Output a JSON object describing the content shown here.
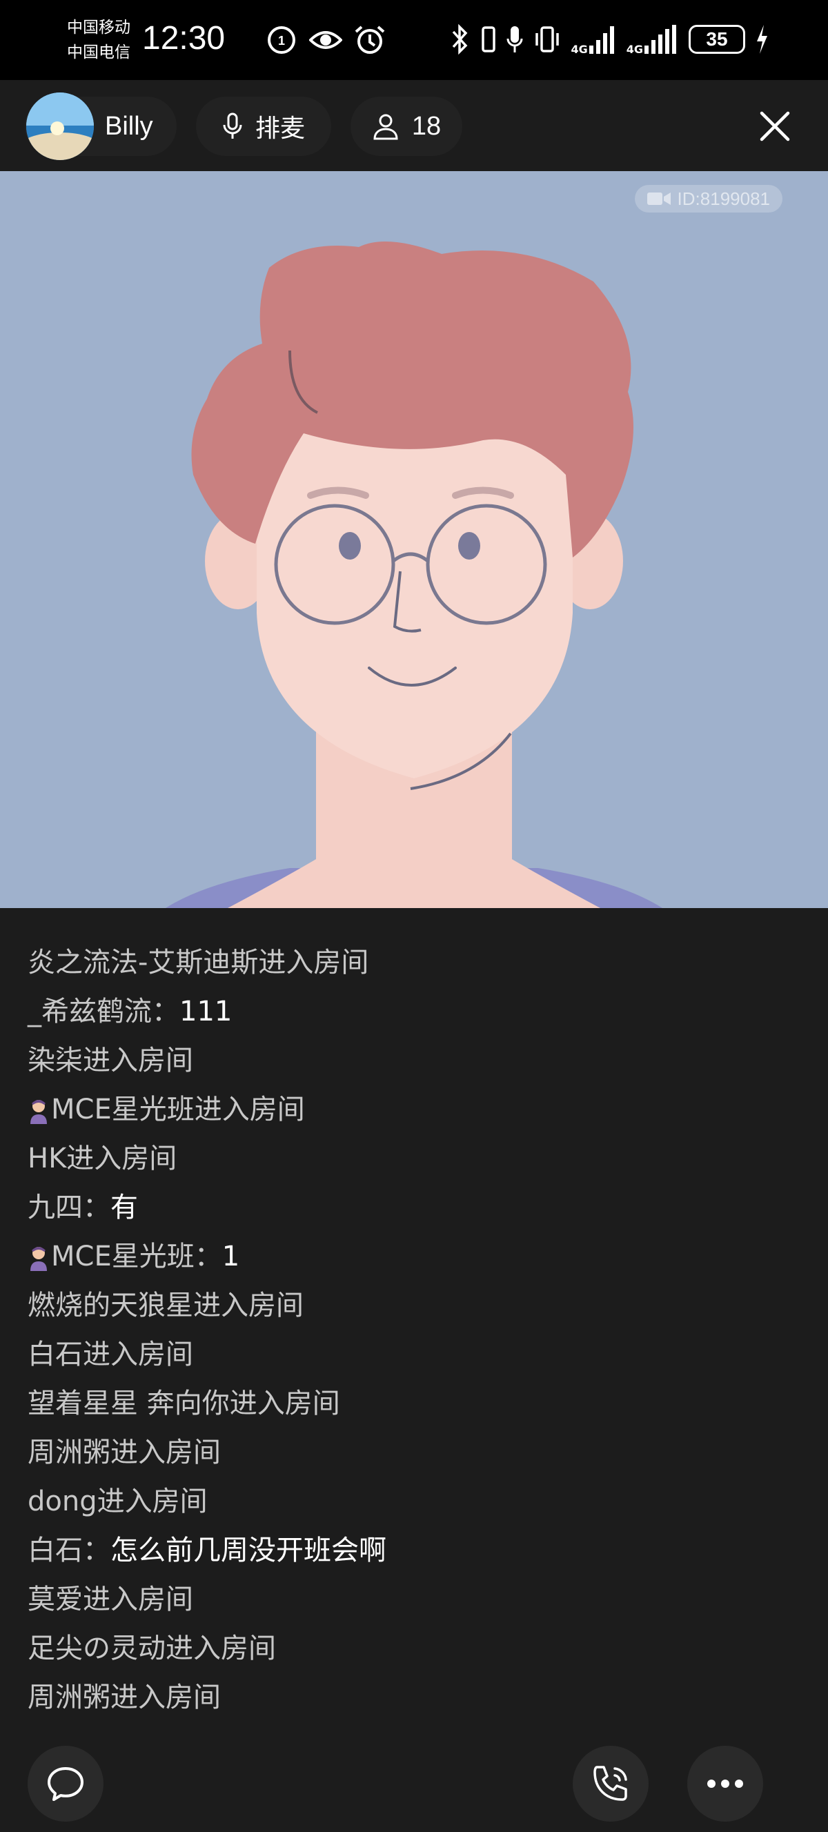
{
  "status_bar": {
    "carrier_1": "中国移动",
    "carrier_2": "中国电信",
    "time": "12:30",
    "icons": [
      "hd-call-icon",
      "eye-comfort-icon",
      "alarm-icon",
      "bluetooth-icon",
      "vibrate-icon",
      "microphone-icon",
      "vibrate-mode-icon",
      "signal-4g-icon",
      "signal-4g-icon"
    ],
    "network_label_1": "4G",
    "network_label_2": "4G",
    "battery": "35"
  },
  "header": {
    "host_name": "Billy",
    "mic_queue_label": "排麦",
    "viewer_count": "18",
    "icons": [
      "microphone-icon",
      "person-icon",
      "close-icon"
    ]
  },
  "video": {
    "room_id": "ID:8199081",
    "background_color": "#9fb1cc"
  },
  "chat": {
    "messages": [
      {
        "user": "炎之流法-艾斯迪斯进入房间",
        "text": ""
      },
      {
        "user": "_希兹鹤流：",
        "text": "111"
      },
      {
        "user": "染柒进入房间",
        "text": ""
      },
      {
        "user": "MCE星光班进入房间",
        "text": "",
        "badge": true
      },
      {
        "user": "HK进入房间",
        "text": ""
      },
      {
        "user": "九四：",
        "text": "有"
      },
      {
        "user": "MCE星光班：",
        "text": "1",
        "badge": true
      },
      {
        "user": "燃烧的天狼星进入房间",
        "text": ""
      },
      {
        "user": "白石进入房间",
        "text": ""
      },
      {
        "user": "望着星星 奔向你进入房间",
        "text": ""
      },
      {
        "user": "周洲粥进入房间",
        "text": ""
      },
      {
        "user": "dong进入房间",
        "text": ""
      },
      {
        "user": "白石：",
        "text": "怎么前几周没开班会啊"
      },
      {
        "user": "莫爱进入房间",
        "text": ""
      },
      {
        "user": "足尖の灵动进入房间",
        "text": ""
      },
      {
        "user": "周洲粥进入房间",
        "text": ""
      }
    ]
  },
  "bottom_bar": {
    "icons": [
      "chat-bubble-icon",
      "phone-call-icon",
      "more-icon"
    ]
  }
}
